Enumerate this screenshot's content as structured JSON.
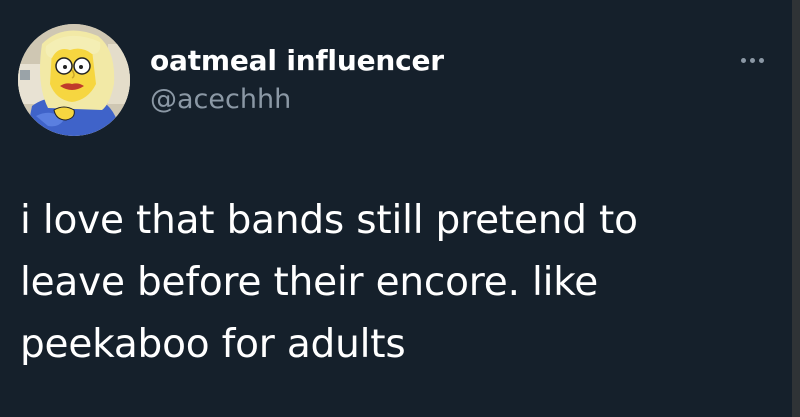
{
  "tweet": {
    "avatar_icon": "cartoon-avatar",
    "display_name": "oatmeal influencer",
    "handle": "@acechhh",
    "more_icon": "more-options-icon",
    "text_lines": [
      "i love that bands still pretend to",
      "leave before their encore. like",
      "peekaboo for adults"
    ]
  },
  "colors": {
    "background": "#15202b",
    "text": "#ffffff",
    "secondary_text": "#8b98a5"
  }
}
